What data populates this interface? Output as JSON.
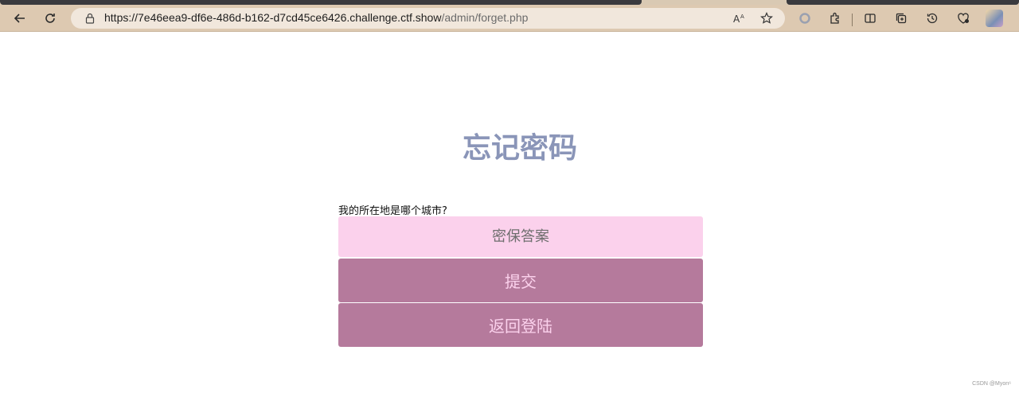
{
  "browser": {
    "url_host": "https://7e46eea9-df6e-486d-b162-d7cd45ce6426.challenge.ctf.show",
    "url_path": "/admin/forget.php",
    "icons": [
      "back-icon",
      "refresh-icon",
      "lock-icon",
      "read-aloud-icon",
      "favorite-star-icon",
      "circle-icon",
      "extensions-icon",
      "split-screen-icon",
      "collections-icon",
      "history-icon",
      "performance-icon",
      "profile-avatar-icon"
    ]
  },
  "page": {
    "title": "忘记密码",
    "question": "我的所在地是哪个城市?",
    "answer_placeholder": "密保答案",
    "submit_label": "提交",
    "back_label": "返回登陆",
    "watermark": "CSDN @Myon⁶"
  },
  "colors": {
    "title": "#8a95b8",
    "input_bg": "#fbd1ec",
    "button_bg": "#b57a9c",
    "button_text": "#fbd1ec",
    "chrome": "#ddc9b1"
  }
}
